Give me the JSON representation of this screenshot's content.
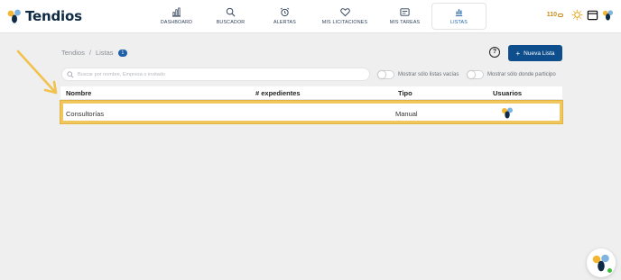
{
  "app": {
    "name": "Tendios",
    "logo_icon": "tendios-logo-icon"
  },
  "nav": {
    "items": [
      {
        "label": "DASHBOARD",
        "icon": "bar-chart-icon",
        "active": false
      },
      {
        "label": "BUSCADOR",
        "icon": "search-icon",
        "active": false
      },
      {
        "label": "ALERTAS",
        "icon": "alarm-clock-icon",
        "active": false
      },
      {
        "label": "MIS LICITACIONES",
        "icon": "heart-icon",
        "active": false
      },
      {
        "label": "MIS TAREAS",
        "icon": "tasks-icon",
        "active": false
      },
      {
        "label": "LISTAS",
        "icon": "list-chart-icon",
        "active": true
      }
    ]
  },
  "header": {
    "credits": "110",
    "theme_icon": "sun-icon",
    "calendar_icon": "calendar-icon",
    "avatar_icon": "user-avatar-icon"
  },
  "breadcrumb": {
    "root": "Tendios",
    "separator": "/",
    "current": "Listas",
    "count": "1"
  },
  "actions": {
    "help_label": "?",
    "new_list_label": "Nueva Lista",
    "new_list_prefix": "+"
  },
  "search": {
    "placeholder": "Buscar por nombre, Empresa o invitado",
    "value": ""
  },
  "toggles": [
    {
      "label": "Mostrar sólo listas vacías",
      "on": false
    },
    {
      "label": "Mostrar sólo donde participo",
      "on": false
    }
  ],
  "table": {
    "columns": [
      "Nombre",
      "# expedientes",
      "Tipo",
      "Usuarios"
    ],
    "rows": [
      {
        "nombre": "Consultorías",
        "expedientes": "",
        "tipo": "Manual",
        "usuarios_icon": "user-avatar-icon"
      }
    ]
  },
  "colors": {
    "accent": "#0e4e8c",
    "highlight": "#f0c65e",
    "brand_yellow": "#f2b632",
    "brand_blue": "#7fb4e0",
    "brand_dark": "#0f2a44"
  }
}
